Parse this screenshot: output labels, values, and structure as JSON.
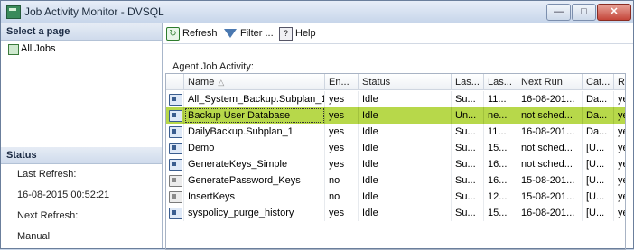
{
  "window": {
    "title": "Job Activity Monitor - DVSQL",
    "buttons": {
      "minimize": "—",
      "maximize": "□",
      "close": "✕"
    }
  },
  "left": {
    "select_header": "Select a page",
    "pages": [
      {
        "label": "All Jobs",
        "icon": "jobs-icon"
      }
    ],
    "status_header": "Status",
    "last_refresh_label": "Last Refresh:",
    "last_refresh_value": "16-08-2015 00:52:21",
    "next_refresh_label": "Next Refresh:",
    "next_refresh_value": "Manual"
  },
  "toolbar": {
    "refresh": "Refresh",
    "filter": "Filter ...",
    "help": "Help"
  },
  "section_label": "Agent Job Activity:",
  "grid": {
    "headers": {
      "name": "Name",
      "en": "En...",
      "status": "Status",
      "last1": "Las...",
      "last2": "Las...",
      "next": "Next Run",
      "cat": "Cat...",
      "r": "R"
    },
    "sort_indicator": "△",
    "rows": [
      {
        "name": "All_System_Backup.Subplan_1",
        "en": "yes",
        "status": "Idle",
        "last1": "Su...",
        "last2": "11...",
        "next": "16-08-201...",
        "cat": "Da...",
        "r": "ye",
        "selected": false,
        "enabled": true
      },
      {
        "name": "Backup User Database",
        "en": "yes",
        "status": "Idle",
        "last1": "Un...",
        "last2": "ne...",
        "next": "not sched...",
        "cat": "Da...",
        "r": "ye",
        "selected": true,
        "enabled": true
      },
      {
        "name": "DailyBackup.Subplan_1",
        "en": "yes",
        "status": "Idle",
        "last1": "Su...",
        "last2": "11...",
        "next": "16-08-201...",
        "cat": "Da...",
        "r": "ye",
        "selected": false,
        "enabled": true
      },
      {
        "name": "Demo",
        "en": "yes",
        "status": "Idle",
        "last1": "Su...",
        "last2": "15...",
        "next": "not sched...",
        "cat": "[U...",
        "r": "ye",
        "selected": false,
        "enabled": true
      },
      {
        "name": "GenerateKeys_Simple",
        "en": "yes",
        "status": "Idle",
        "last1": "Su...",
        "last2": "16...",
        "next": "not sched...",
        "cat": "[U...",
        "r": "ye",
        "selected": false,
        "enabled": true
      },
      {
        "name": "GeneratePassword_Keys",
        "en": "no",
        "status": "Idle",
        "last1": "Su...",
        "last2": "16...",
        "next": "15-08-201...",
        "cat": "[U...",
        "r": "ye",
        "selected": false,
        "enabled": false
      },
      {
        "name": "InsertKeys",
        "en": "no",
        "status": "Idle",
        "last1": "Su...",
        "last2": "12...",
        "next": "15-08-201...",
        "cat": "[U...",
        "r": "ye",
        "selected": false,
        "enabled": false
      },
      {
        "name": "syspolicy_purge_history",
        "en": "yes",
        "status": "Idle",
        "last1": "Su...",
        "last2": "15...",
        "next": "16-08-201...",
        "cat": "[U...",
        "r": "ye",
        "selected": false,
        "enabled": true
      }
    ]
  },
  "colors": {
    "selected_row": "#b7d84a",
    "title_gradient_top": "#e7eef8",
    "title_gradient_bottom": "#c7d6ea"
  }
}
